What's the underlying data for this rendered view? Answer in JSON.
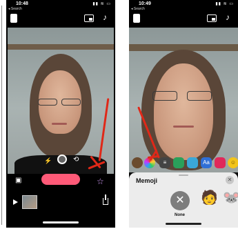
{
  "left_phone": {
    "status": {
      "time": "10:48",
      "back_label": "◂ Search",
      "indicators": "▮▮ ≋ ▭"
    },
    "toolbar": {
      "doc_icon": "document-icon",
      "layout_icon": "layout-icon",
      "music_icon": "♪"
    },
    "controls": {
      "flash_icon": "⚡",
      "flip_icon": "⟲",
      "effects_icon": "☆",
      "side_icon": "▣"
    },
    "record_button_color": "#ff5a78"
  },
  "right_phone": {
    "status": {
      "time": "10:49",
      "back_label": "◂ Search",
      "indicators": "▮▮ ≋ ▭"
    },
    "toolbar": {
      "doc_icon": "document-icon",
      "layout_icon": "layout-icon",
      "music_icon": "♪"
    },
    "effects": [
      {
        "name": "memoji-effect",
        "glyph": ""
      },
      {
        "name": "filters-effect",
        "glyph": ""
      },
      {
        "name": "text-effect",
        "glyph": "≡"
      },
      {
        "name": "shapes-effect",
        "glyph": ""
      },
      {
        "name": "photos-effect",
        "glyph": ""
      },
      {
        "name": "labels-effect",
        "glyph": "Aa"
      },
      {
        "name": "stickers-effect",
        "glyph": ""
      },
      {
        "name": "emoji-effect",
        "glyph": "☺"
      }
    ],
    "memoji_panel": {
      "title": "Memoji",
      "close": "✕",
      "none_symbol": "✕",
      "none_label": "None",
      "faces": [
        "🧑",
        "🐭"
      ]
    }
  },
  "colors": {
    "accent_red": "#e02818",
    "record_pink": "#ff5a78"
  }
}
